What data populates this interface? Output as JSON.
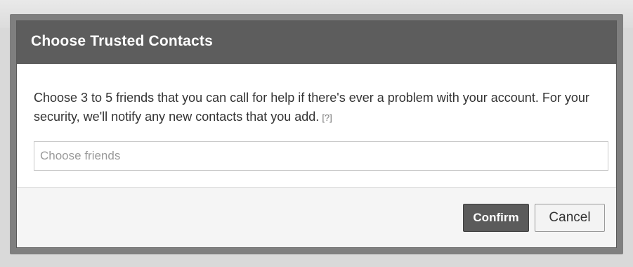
{
  "dialog": {
    "title": "Choose Trusted Contacts",
    "message": "Choose 3 to 5 friends that you can call for help if there's ever a problem with your account. For your security, we'll notify any new contacts that you add.",
    "help_link": "[?]",
    "input_placeholder": "Choose friends",
    "input_value": "",
    "confirm_label": "Confirm",
    "cancel_label": "Cancel"
  },
  "colors": {
    "header_bg": "#5d5d5d",
    "confirm_bg": "#5b5b5b",
    "overlay": "#7f7f7f"
  }
}
